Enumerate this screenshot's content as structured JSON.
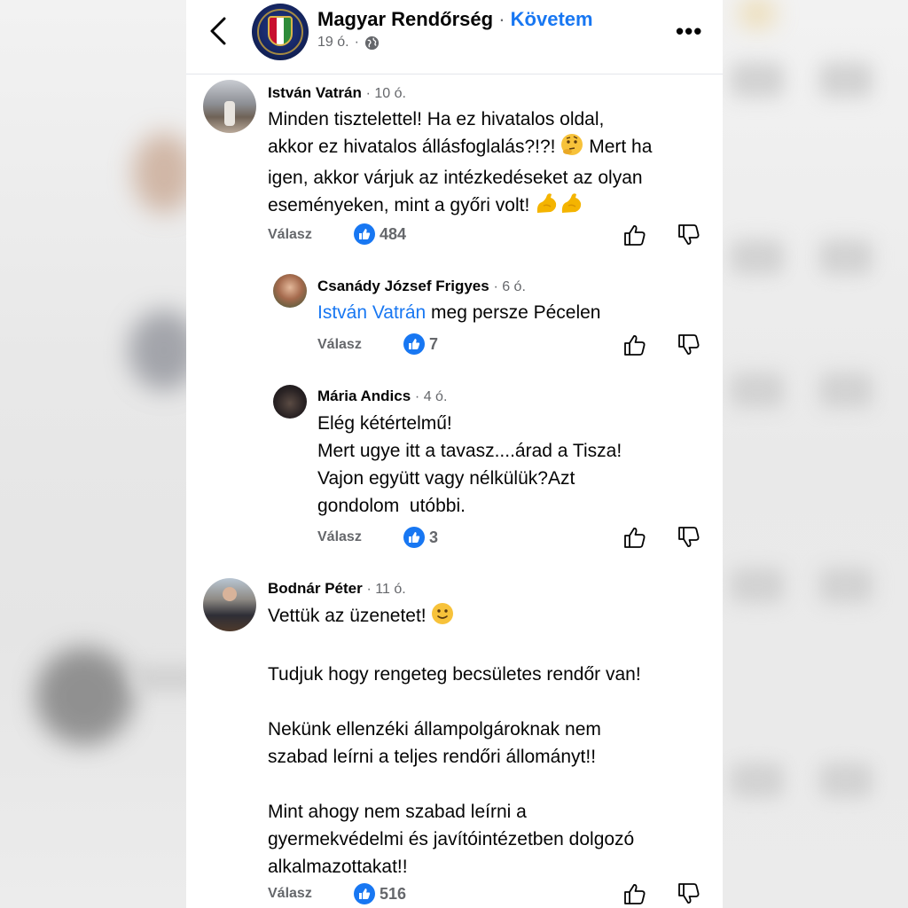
{
  "header": {
    "page_name": "Magyar Rendőrség",
    "separator": "·",
    "follow_label": "Követem",
    "age": "19 ó.",
    "age_separator": "·",
    "more_label": "•••"
  },
  "comments": [
    {
      "author": "István Vatrán",
      "time": "· 10 ó.",
      "lines": [
        "Minden tisztelettel! Ha ez hivatalos oldal,",
        "akkor ez hivatalos állásfoglalás?!?!",
        "igen, akkor várjuk az intézkedéseket az olyan",
        "eseményeken, mint a győri volt!"
      ],
      "line2_tail": "Mert ha",
      "reply_label": "Válasz",
      "likes": "484"
    },
    {
      "author": "Csanády József Frigyes",
      "time": "· 6 ó.",
      "mention": "István Vatrán",
      "text": "meg persze Pécelen",
      "reply_label": "Válasz",
      "likes": "7"
    },
    {
      "author": "Mária Andics",
      "time": "· 4 ó.",
      "lines": [
        "Elég kétértelmű!",
        "Mert ugye itt a tavasz....árad a Tisza!",
        "Vajon együtt vagy nélkülük?Azt",
        "gondolom  utóbbi."
      ],
      "reply_label": "Válasz",
      "likes": "3"
    },
    {
      "author": "Bodnár Péter",
      "time": "· 11 ó.",
      "lines": [
        "Vettük az üzenetet!",
        "Tudjuk hogy rengeteg becsületes rendőr van!",
        "Nekünk ellenzéki állampolgároknak nem",
        "szabad leírni a teljes rendőri állományt!!",
        "Mint ahogy nem szabad leírni a",
        "gyermekvédelmi és javítóintézetben dolgozó",
        "alkalmazottakat!!"
      ],
      "reply_label": "Válasz",
      "likes": "516"
    }
  ],
  "icons": {
    "back": "chevron-left-icon",
    "globe": "globe-icon",
    "like": "thumbs-up-icon",
    "dislike": "thumbs-down-icon",
    "thinking": "thinking-face-emoji",
    "muscle": "flexed-biceps-emoji",
    "smile": "slightly-smiling-face-emoji"
  },
  "colors": {
    "accent": "#1877f2",
    "muted": "#65676b",
    "text": "#050505"
  }
}
